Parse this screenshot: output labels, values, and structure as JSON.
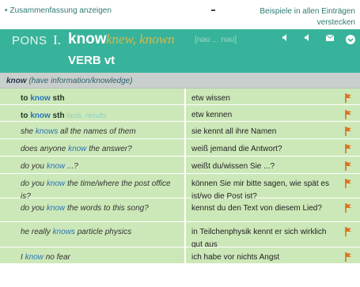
{
  "topbar": {
    "summary_link": "Zusammenfassung anzeigen",
    "hide_examples_link": "Beispiele in allen Einträgen verstecken"
  },
  "entry": {
    "source": "PONS",
    "number": "I.",
    "headword": "know",
    "forms": "knew, known",
    "pronunciation": "[nəʊ ... nəʊ]",
    "part_of_speech": "VERB vt",
    "icons": [
      "speaker-icon",
      "speaker-icon",
      "mail-icon",
      "plus-circle-icon"
    ]
  },
  "sense": {
    "word": "know",
    "gloss": "(have information/knowledge)"
  },
  "rows": [
    {
      "left_pre": "to ",
      "left_kw": "know",
      "left_post": " sth",
      "context": "",
      "right": "etw wissen",
      "bold": true
    },
    {
      "left_pre": "to ",
      "left_kw": "know",
      "left_post": " sth",
      "context": "facts, results",
      "right": "etw kennen",
      "bold": true
    },
    {
      "left_pre": "she ",
      "left_kw": "knows",
      "left_post": " all the names of them",
      "context": "",
      "right": "sie kennt all ihre Namen",
      "bold": false
    },
    {
      "left_pre": "does anyone ",
      "left_kw": "know",
      "left_post": " the answer?",
      "context": "",
      "right": "weiß jemand die Antwort?",
      "bold": false
    },
    {
      "left_pre": "do you ",
      "left_kw": "know",
      "left_post": " ...?",
      "context": "",
      "right": "weißt du/wissen Sie ...?",
      "bold": false
    },
    {
      "left_pre": "do you ",
      "left_kw": "know",
      "left_post": " the time/where the post office is?",
      "context": "",
      "right": "können Sie mir bitte sagen, wie spät es ist/wo die Post ist?",
      "bold": false
    },
    {
      "left_pre": "do you ",
      "left_kw": "know",
      "left_post": " the words to this song?",
      "context": "",
      "right": "kennst du den Text von diesem Lied?",
      "bold": false
    },
    {
      "left_pre": "he really ",
      "left_kw": "knows",
      "left_post": " particle physics",
      "context": "",
      "right": "in Teilchenphysik kennt er sich wirklich gut aus",
      "bold": false
    },
    {
      "left_pre": "I ",
      "left_kw": "know",
      "left_post": " no fear",
      "context": "",
      "right": "ich habe vor nichts Angst",
      "bold": false
    }
  ],
  "colors": {
    "header_bg": "#37b39b",
    "row_bg": "#cce8b8",
    "sense_bg": "#c9cfcc",
    "keyword": "#2a73b8",
    "forms": "#d9b84a",
    "flag": "#d9721e"
  }
}
